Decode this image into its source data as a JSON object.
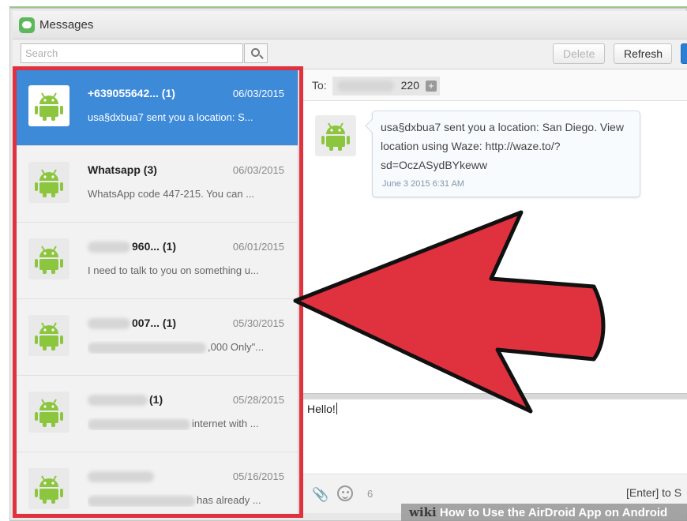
{
  "window": {
    "title": "Messages"
  },
  "toolbar": {
    "search_placeholder": "Search",
    "delete_label": "Delete",
    "refresh_label": "Refresh"
  },
  "conversations": [
    {
      "sender": "+639055642...  (1)",
      "date": "06/03/2015",
      "preview": "usa§dxbua7 sent you a location: S...",
      "active": true
    },
    {
      "sender": "Whatsapp (3)",
      "date": "06/03/2015",
      "preview": "WhatsApp code 447-215. You can ..."
    },
    {
      "sender": "960...  (1)",
      "date": "06/01/2015",
      "preview": "I need to talk to you on something u..."
    },
    {
      "sender": "007...  (1)",
      "date": "05/30/2015",
      "preview": ",000 Only\"..."
    },
    {
      "sender": "(1)",
      "date": "05/28/2015",
      "preview": "internet with ..."
    },
    {
      "sender": "",
      "date": "05/16/2015",
      "preview": "has already ..."
    }
  ],
  "conversation": {
    "to_label": "To:",
    "to_value": "220",
    "to_plus": "+",
    "message_text": "usa§dxbua7 sent you a location: San Diego. View location using Waze: http://waze.to/?sd=OczASydBYkeww",
    "message_time": "June 3 2015 6:31 AM"
  },
  "compose": {
    "text": "Hello!",
    "char_count": "6",
    "enter_hint": "[Enter] to S"
  },
  "watermark": {
    "brand": "wiki",
    "text": "How to Use the AirDroid App on Android"
  },
  "colors": {
    "selected": "#3d8ad8",
    "highlight_box": "#e0313f",
    "android_green": "#8cc63f"
  },
  "icons": [
    "messages-app-icon",
    "search-icon",
    "android-avatar-icon",
    "add-recipient-icon",
    "attachment-icon",
    "emoji-icon",
    "arrow-annotation"
  ]
}
